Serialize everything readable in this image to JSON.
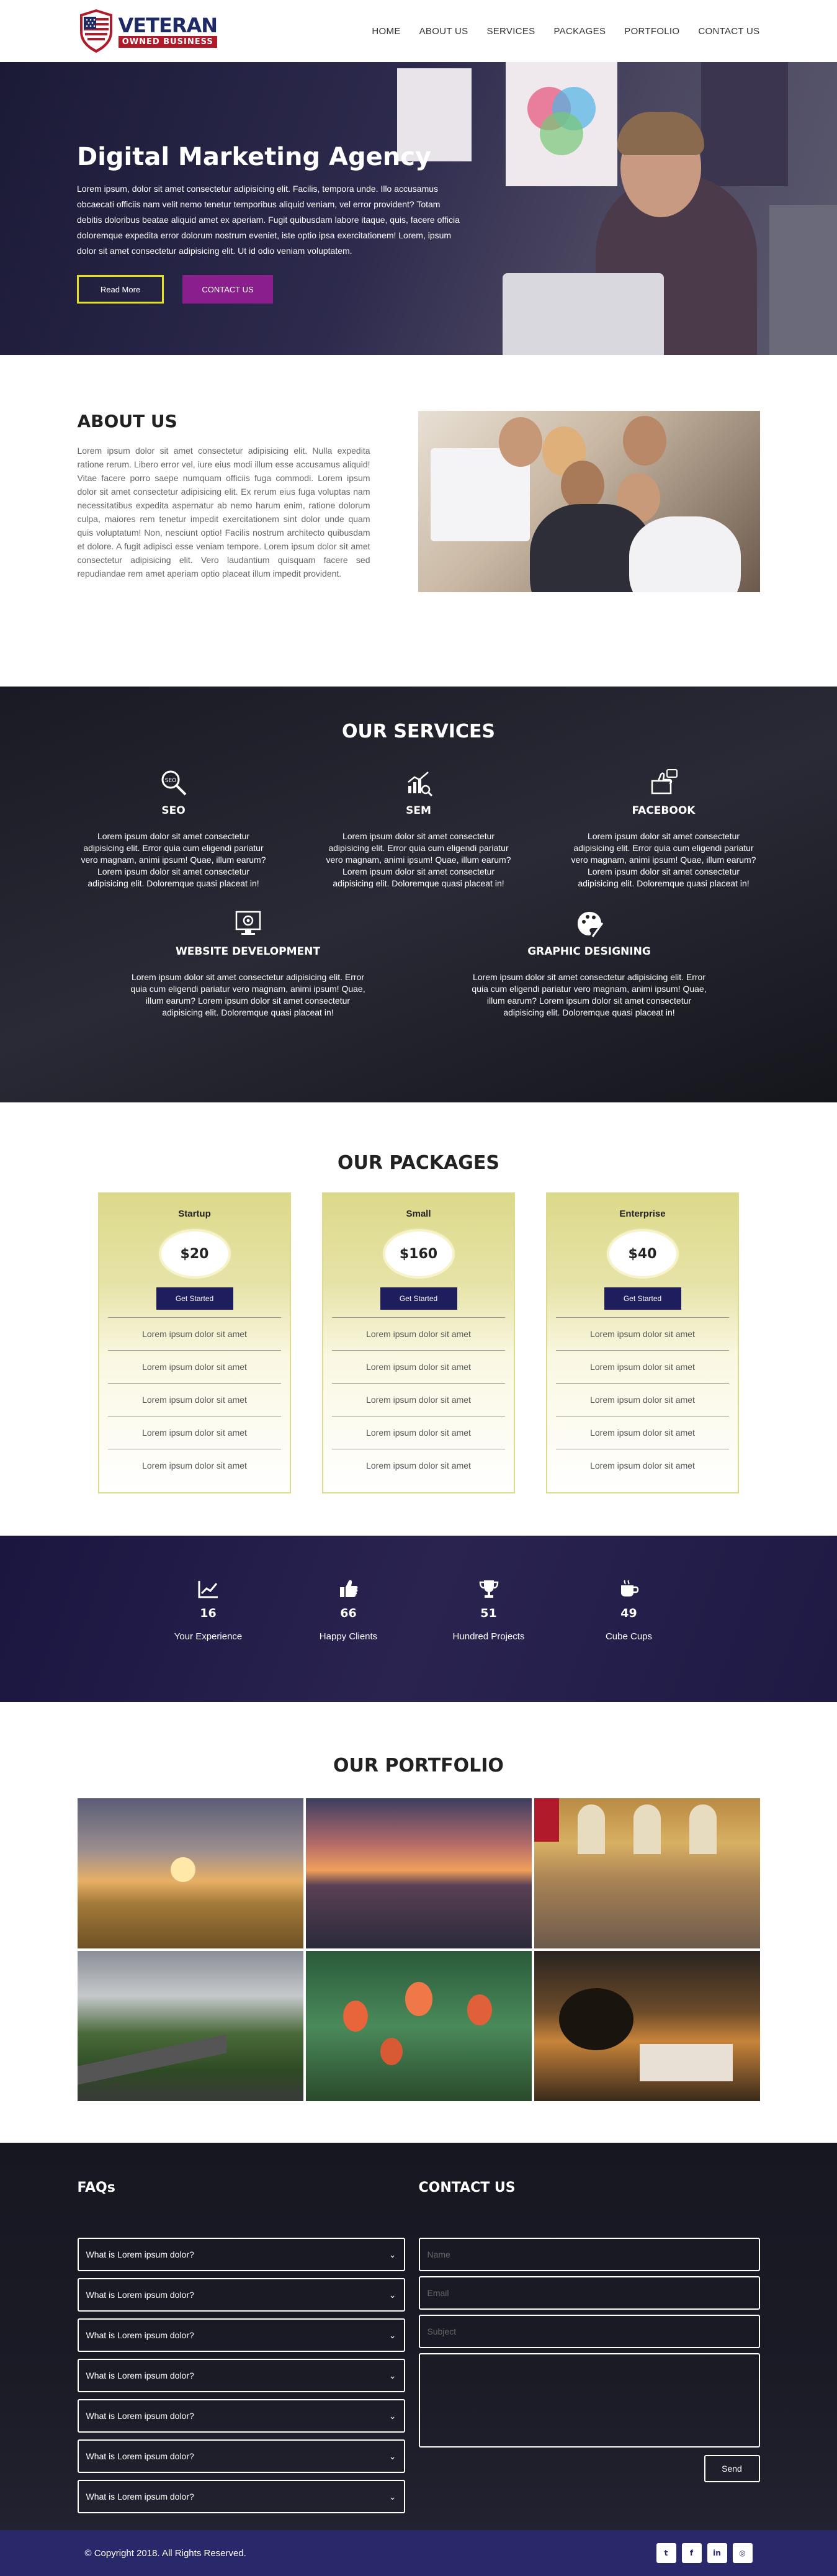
{
  "brand": {
    "line1": "VETERAN",
    "line2": "OWNED BUSINESS"
  },
  "nav": [
    {
      "label": "HOME"
    },
    {
      "label": "ABOUT US"
    },
    {
      "label": "SERVICES"
    },
    {
      "label": "PACKAGES"
    },
    {
      "label": "PORTFOLIO"
    },
    {
      "label": "CONTACT US"
    }
  ],
  "hero": {
    "title": "Digital Marketing Agency",
    "text": "Lorem ipsum, dolor sit amet consectetur adipisicing elit. Facilis, tempora unde. Illo accusamus obcaecati officiis nam velit nemo tenetur temporibus aliquid veniam, vel error provident? Totam debitis doloribus beatae aliquid amet ex aperiam. Fugit quibusdam labore itaque, quis, facere officia doloremque expedita error dolorum nostrum eveniet, iste optio ipsa exercitationem! Lorem, ipsum dolor sit amet consectetur adipisicing elit. Ut id odio veniam voluptatem.",
    "read_more": "Read More",
    "contact": "CONTACT US"
  },
  "about": {
    "title": "ABOUT US",
    "text": "Lorem ipsum dolor sit amet consectetur adipisicing elit. Nulla expedita ratione rerum. Libero error vel, iure eius modi illum esse accusamus aliquid! Vitae facere porro saepe numquam officiis fuga commodi. Lorem ipsum dolor sit amet consectetur adipisicing elit. Ex rerum eius fuga voluptas nam necessitatibus expedita aspernatur ab nemo harum enim, ratione dolorum culpa, maiores rem tenetur impedit exercitationem sint dolor unde quam quis voluptatum! Non, nesciunt optio! Facilis nostrum architecto quibusdam et dolore. A fugit adipisci esse veniam tempore. Lorem ipsum dolor sit amet consectetur adipisicing elit. Vero laudantium quisquam facere sed repudiandae rem amet aperiam optio placeat illum impedit provident."
  },
  "services": {
    "title": "OUR SERVICES",
    "items": [
      {
        "title": "SEO",
        "icon": "seo-search-icon",
        "text": "Lorem ipsum dolor sit amet consectetur adipisicing elit. Error quia cum eligendi pariatur vero magnam, animi ipsum! Quae, illum earum? Lorem ipsum dolor sit amet consectetur adipisicing elit. Doloremque quasi placeat in!"
      },
      {
        "title": "SEM",
        "icon": "sem-chart-icon",
        "text": "Lorem ipsum dolor sit amet consectetur adipisicing elit. Error quia cum eligendi pariatur vero magnam, animi ipsum! Quae, illum earum? Lorem ipsum dolor sit amet consectetur adipisicing elit. Doloremque quasi placeat in!"
      },
      {
        "title": "FACEBOOK",
        "icon": "facebook-like-icon",
        "text": "Lorem ipsum dolor sit amet consectetur adipisicing elit. Error quia cum eligendi pariatur vero magnam, animi ipsum! Quae, illum earum? Lorem ipsum dolor sit amet consectetur adipisicing elit. Doloremque quasi placeat in!"
      },
      {
        "title": "WEBSITE DEVELOPMENT",
        "icon": "monitor-gear-icon",
        "text": "Lorem ipsum dolor sit amet consectetur adipisicing elit. Error quia cum eligendi pariatur vero magnam, animi ipsum! Quae, illum earum? Lorem ipsum dolor sit amet consectetur adipisicing elit. Doloremque quasi placeat in!"
      },
      {
        "title": "GRAPHIC DESIGNING",
        "icon": "palette-icon",
        "text": "Lorem ipsum dolor sit amet consectetur adipisicing elit. Error quia cum eligendi pariatur vero magnam, animi ipsum! Quae, illum earum? Lorem ipsum dolor sit amet consectetur adipisicing elit. Doloremque quasi placeat in!"
      }
    ]
  },
  "packages": {
    "title": "OUR PACKAGES",
    "button": "Get Started",
    "items": [
      {
        "name": "Startup",
        "price": "$20",
        "features": [
          "Lorem ipsum dolor sit amet",
          "Lorem ipsum dolor sit amet",
          "Lorem ipsum dolor sit amet",
          "Lorem ipsum dolor sit amet",
          "Lorem ipsum dolor sit amet"
        ]
      },
      {
        "name": "Small",
        "price": "$160",
        "features": [
          "Lorem ipsum dolor sit amet",
          "Lorem ipsum dolor sit amet",
          "Lorem ipsum dolor sit amet",
          "Lorem ipsum dolor sit amet",
          "Lorem ipsum dolor sit amet"
        ]
      },
      {
        "name": "Enterprise",
        "price": "$40",
        "features": [
          "Lorem ipsum dolor sit amet",
          "Lorem ipsum dolor sit amet",
          "Lorem ipsum dolor sit amet",
          "Lorem ipsum dolor sit amet",
          "Lorem ipsum dolor sit amet"
        ]
      }
    ]
  },
  "counters": [
    {
      "icon": "chart-line-icon",
      "value": "16",
      "label": "Your Experience"
    },
    {
      "icon": "thumbs-up-icon",
      "value": "66",
      "label": "Happy Clients"
    },
    {
      "icon": "trophy-icon",
      "value": "51",
      "label": "Hundred Projects"
    },
    {
      "icon": "coffee-cup-icon",
      "value": "49",
      "label": "Cube Cups"
    }
  ],
  "portfolio": {
    "title": "OUR PORTFOLIO"
  },
  "faq": {
    "title": "FAQs",
    "items": [
      {
        "q": "What is Lorem ipsum dolor?"
      },
      {
        "q": "What is Lorem ipsum dolor?"
      },
      {
        "q": "What is Lorem ipsum dolor?"
      },
      {
        "q": "What is Lorem ipsum dolor?"
      },
      {
        "q": "What is Lorem ipsum dolor?"
      },
      {
        "q": "What is Lorem ipsum dolor?"
      },
      {
        "q": "What is Lorem ipsum dolor?"
      }
    ]
  },
  "contact": {
    "title": "CONTACT US",
    "name_placeholder": "Name",
    "email_placeholder": "Email",
    "subject_placeholder": "Subject",
    "send": "Send"
  },
  "footer": {
    "copyright": "© Copyright 2018. All Rights Reserved.",
    "social": [
      {
        "icon": "twitter-icon",
        "glyph": "t"
      },
      {
        "icon": "facebook-icon",
        "glyph": "f"
      },
      {
        "icon": "linkedin-icon",
        "glyph": "in"
      },
      {
        "icon": "instagram-icon",
        "glyph": "◎"
      }
    ]
  },
  "colors": {
    "accent_yellow": "#e6e11f",
    "accent_purple": "#8a1e8c",
    "navy": "#1e1e5e",
    "footer": "#28286a"
  }
}
